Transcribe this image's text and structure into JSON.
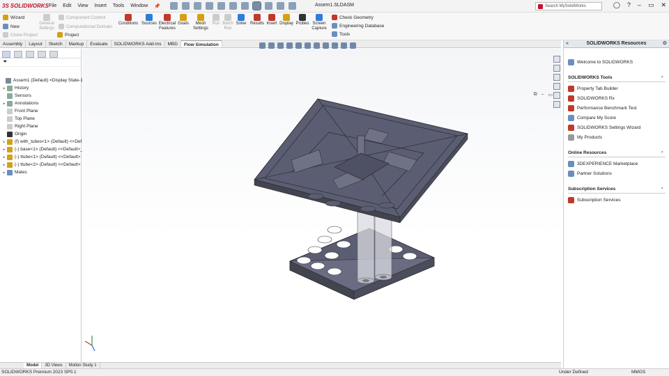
{
  "app": {
    "logo": "SOLIDWORKS",
    "menu": [
      "File",
      "Edit",
      "View",
      "Insert",
      "Tools",
      "Window"
    ],
    "doc_title": "Assem1.SLDASM",
    "search_placeholder": "Search MySolidWorks"
  },
  "ribbon": {
    "left": [
      {
        "label": "Wizard",
        "enabled": true
      },
      {
        "label": "New",
        "enabled": true
      },
      {
        "label": "Clone Project",
        "enabled": false
      }
    ],
    "general_settings": "General Settings",
    "component_control": "Component Control",
    "computational_domain": "Computational Domain",
    "project": "Project",
    "buttons": [
      {
        "label": "Conditions",
        "enabled": true,
        "color": "#c0392b"
      },
      {
        "label": "Sources",
        "enabled": true,
        "color": "#2e7dd7"
      },
      {
        "label": "Electrical Features",
        "enabled": true,
        "color": "#c0392b"
      },
      {
        "label": "Goals",
        "enabled": true,
        "color": "#d4a017"
      },
      {
        "label": "Mesh Settings",
        "enabled": true,
        "color": "#d4a017"
      },
      {
        "label": "Run",
        "enabled": false,
        "color": "#9aa"
      },
      {
        "label": "Batch Run",
        "enabled": false,
        "color": "#9aa"
      },
      {
        "label": "Solve",
        "enabled": true,
        "color": "#2e7dd7"
      },
      {
        "label": "Results",
        "enabled": true,
        "color": "#c0392b"
      },
      {
        "label": "Insert",
        "enabled": true,
        "color": "#c0392b"
      },
      {
        "label": "Display",
        "enabled": true,
        "color": "#d4a017"
      },
      {
        "label": "Probes",
        "enabled": true,
        "color": "#333"
      },
      {
        "label": "Screen Capture",
        "enabled": true,
        "color": "#2e7dd7"
      }
    ],
    "right": [
      {
        "label": "Check Geometry"
      },
      {
        "label": "Engineering Database"
      },
      {
        "label": "Tools"
      }
    ]
  },
  "tabs": [
    "Assembly",
    "Layout",
    "Sketch",
    "Markup",
    "Evaluate",
    "SOLIDWORKS Add-Ins",
    "MBD",
    "Flow Simulation"
  ],
  "active_tab": "Flow Simulation",
  "tree": [
    {
      "label": "Assem1 (Default) <Display State-1>",
      "indent": 0,
      "exp": "",
      "icon": "#7a8a99"
    },
    {
      "label": "History",
      "indent": 1,
      "exp": "▸",
      "icon": "#8a9"
    },
    {
      "label": "Sensors",
      "indent": 1,
      "exp": "",
      "icon": "#8a9"
    },
    {
      "label": "Annotations",
      "indent": 1,
      "exp": "▸",
      "icon": "#8a9"
    },
    {
      "label": "Front Plane",
      "indent": 1,
      "exp": "",
      "icon": "#ccc"
    },
    {
      "label": "Top Plane",
      "indent": 1,
      "exp": "",
      "icon": "#ccc"
    },
    {
      "label": "Right Plane",
      "indent": 1,
      "exp": "",
      "icon": "#ccc"
    },
    {
      "label": "Origin",
      "indent": 1,
      "exp": "",
      "icon": "#333"
    },
    {
      "label": "(f) with_tubes<1> (Default) <<Def",
      "indent": 1,
      "exp": "▸",
      "icon": "#d4a017"
    },
    {
      "label": "(-) base<1> (Default) <<Default>_",
      "indent": 1,
      "exp": "▸",
      "icon": "#d4a017"
    },
    {
      "label": "(-) ttube<1> (Default) <<Default>",
      "indent": 1,
      "exp": "▸",
      "icon": "#d4a017"
    },
    {
      "label": "(-) ttube<2> (Default) <<Default>",
      "indent": 1,
      "exp": "▸",
      "icon": "#d4a017"
    },
    {
      "label": "Mates",
      "indent": 1,
      "exp": "▸",
      "icon": "#6a8fbf"
    }
  ],
  "bottom_tabs": [
    "Model",
    "3D Views",
    "Motion Study 1"
  ],
  "active_bottom_tab": "Model",
  "status": {
    "version": "SOLIDWORKS Premium 2023 SP0.1",
    "state": "Under Defined",
    "units": "MMGS"
  },
  "task_pane": {
    "title": "SOLIDWORKS Resources",
    "welcome": "Welcome to SOLIDWORKS",
    "sections": [
      {
        "title": "SOLIDWORKS Tools",
        "items": [
          "Property Tab Builder",
          "SOLIDWORKS Rx",
          "Performance Benchmark Test",
          "Compare My Score",
          "SOLIDWORKS Settings Wizard",
          "My Products"
        ]
      },
      {
        "title": "Online Resources",
        "items": [
          "3DEXPERIENCE Marketplace",
          "Partner Solutions"
        ]
      },
      {
        "title": "Subscription Services",
        "items": [
          "Subscription Services"
        ]
      }
    ]
  },
  "colors": {
    "brand": "#c8102e",
    "model": "#5b5d72",
    "selection": "#4a6fa5"
  }
}
